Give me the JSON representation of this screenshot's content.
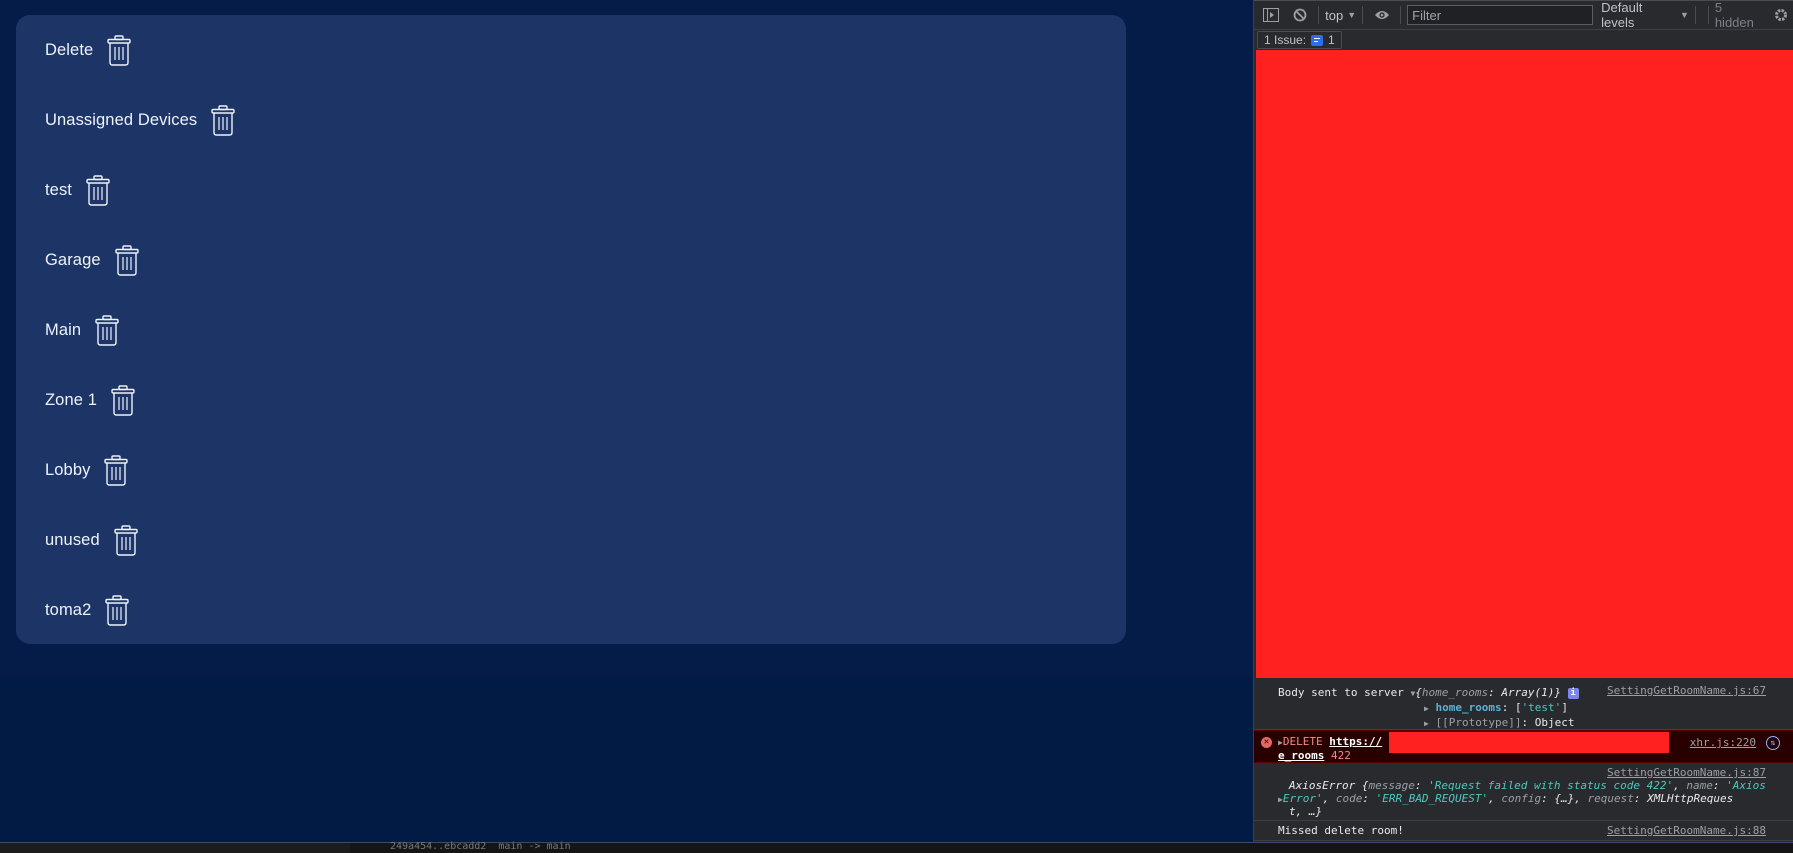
{
  "page": {
    "rooms": [
      {
        "label": "Delete",
        "icon": "trash-icon"
      },
      {
        "label": "Unassigned Devices",
        "icon": "trash-icon"
      },
      {
        "label": "test",
        "icon": "trash-icon"
      },
      {
        "label": "Garage",
        "icon": "trash-icon"
      },
      {
        "label": "Main",
        "icon": "trash-icon"
      },
      {
        "label": "Zone 1",
        "icon": "trash-icon"
      },
      {
        "label": "Lobby",
        "icon": "trash-icon"
      },
      {
        "label": "unused",
        "icon": "trash-icon"
      },
      {
        "label": "toma2",
        "icon": "trash-icon"
      }
    ]
  },
  "statusbar": {
    "text": "249a454..ebcadd2  main -> main"
  },
  "devtools": {
    "toolbar": {
      "context": "top",
      "filter_placeholder": "Filter",
      "levels": "Default levels",
      "hidden": "5 hidden"
    },
    "issues": {
      "label": "1 Issue:",
      "count": "1"
    },
    "console": {
      "log1": {
        "prefix": "Body sent to server",
        "object_open": "{",
        "object_key": "home_rooms",
        "object_val": "Array(1)",
        "object_close": "}",
        "prop1_key": "home_rooms",
        "prop1_val_open": "[",
        "prop1_val_str": "'test'",
        "prop1_val_close": "]",
        "prop2_key": "[[Prototype]]",
        "prop2_val": "Object",
        "source": "SettingGetRoomName.js:67"
      },
      "error": {
        "method": "DELETE",
        "url_start": "https://",
        "url_end": "e_rooms",
        "status": "422",
        "source": "xhr.js:220"
      },
      "axios": {
        "source": "SettingGetRoomName.js:87",
        "line1_name": "AxiosError",
        "line1_rest_key": "message",
        "line1_msg": "'Request failed with status code 422'",
        "line1_name_key": "name",
        "line1_name_val": "'Axios",
        "line2_name_val": "Error'",
        "line2_code_key": "code",
        "line2_code_val": "'ERR_BAD_REQUEST'",
        "line2_config_key": "config",
        "line2_config_val": "{…}",
        "line2_request_key": "request",
        "line2_request_val": "XMLHttpReques",
        "line3": "t, …}"
      },
      "missed": {
        "text": "Missed delete room!",
        "source": "SettingGetRoomName.js:88"
      }
    }
  }
}
